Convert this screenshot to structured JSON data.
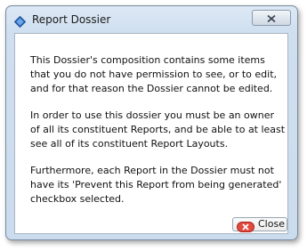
{
  "window": {
    "title": "Report Dossier",
    "icon": "app-diamond-icon",
    "close_icon": "close-x-icon"
  },
  "message": {
    "paragraphs": [
      "This Dossier's composition contains some items that you do not have permission to see, or to edit, and for that reason the Dossier cannot be edited.",
      "In order to use this dossier you must be an owner of all its constituent Reports, and be able to at least see all of its constituent Report Layouts.",
      "Furthermore, each Report in the Dossier must not have its 'Prevent this Report from being generated' checkbox selected."
    ]
  },
  "buttons": {
    "close_label": "Close",
    "close_icon": "red-x-icon"
  },
  "colors": {
    "title_bar": "#cfdff0",
    "close_icon_red": "#d9302a"
  }
}
